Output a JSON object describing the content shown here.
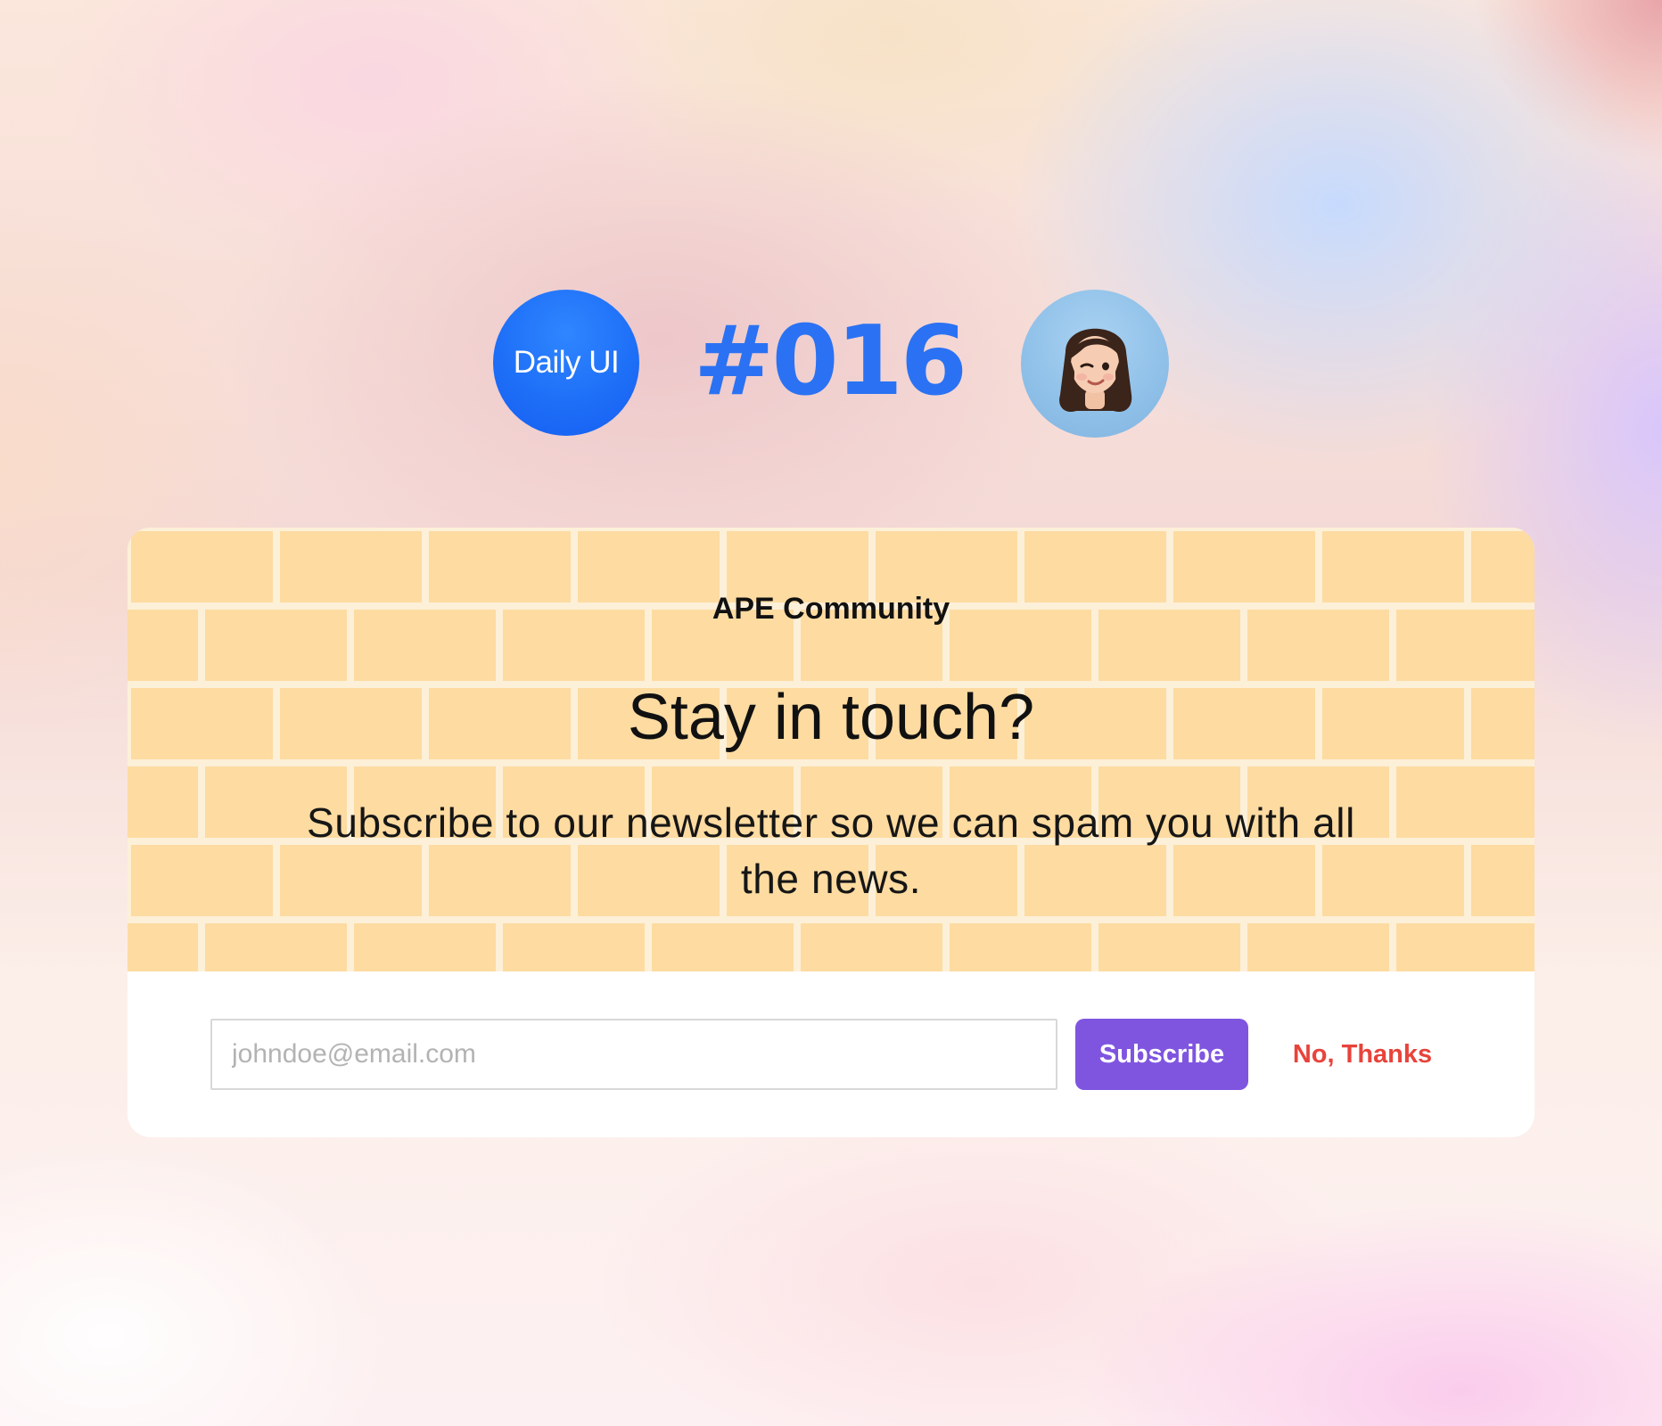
{
  "header": {
    "badge_label": "Daily UI",
    "challenge_number": "#016",
    "avatar_icon": "memoji-avatar-icon"
  },
  "card": {
    "community_name": "APE Community",
    "title": "Stay in touch?",
    "subtitle": "Subscribe to our newsletter so we can spam you with all the news.",
    "email_input": {
      "value": "",
      "placeholder": "johndoe@email.com"
    },
    "subscribe_label": "Subscribe",
    "decline_label": "No, Thanks"
  },
  "colors": {
    "accent_blue": "#2a72f3",
    "brick": "#fddba1",
    "mortar": "#fdf0d8",
    "subscribe_button": "#7f55e0",
    "decline_text": "#e8433b"
  }
}
